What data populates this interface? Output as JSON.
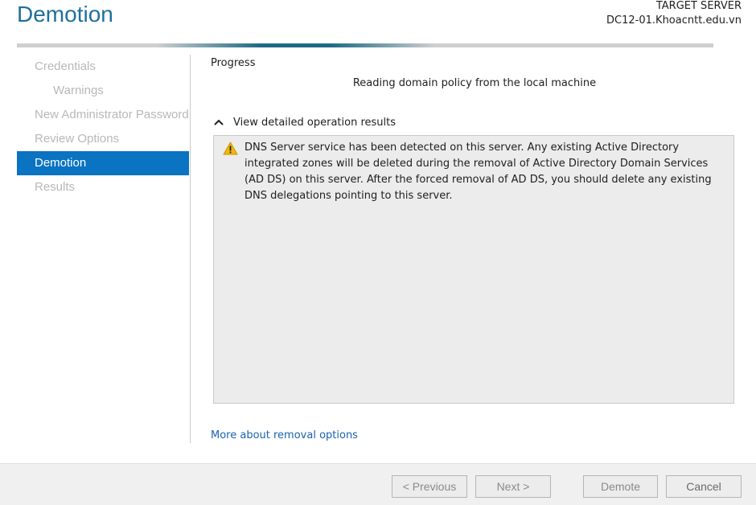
{
  "header": {
    "title": "Demotion",
    "target_label": "TARGET SERVER",
    "target_server": "DC12-01.Khoacntt.edu.vn"
  },
  "nav": {
    "items": [
      {
        "label": "Credentials"
      },
      {
        "label": "Warnings"
      },
      {
        "label": "New Administrator Password"
      },
      {
        "label": "Review Options"
      },
      {
        "label": "Demotion"
      },
      {
        "label": "Results"
      }
    ]
  },
  "main": {
    "progress_label": "Progress",
    "status": "Reading domain policy from the local machine",
    "details_toggle": "View detailed operation results",
    "warning_message": "DNS Server service has been detected on this server. Any existing Active Directory integrated zones will be deleted during the removal of Active Directory Domain Services (AD DS) on this server. After the forced removal of AD DS, you should delete any existing DNS delegations pointing to this server.",
    "more_link": "More about removal options"
  },
  "footer": {
    "previous": "< Previous",
    "next": "Next >",
    "demote": "Demote",
    "cancel": "Cancel"
  },
  "colors": {
    "accent": "#0a73c2",
    "title": "#1f6f9c",
    "link": "#1a62b0",
    "warning": "#f2b705"
  },
  "icons": {
    "toggle": "chevron-up-icon",
    "warning": "warning-icon"
  }
}
